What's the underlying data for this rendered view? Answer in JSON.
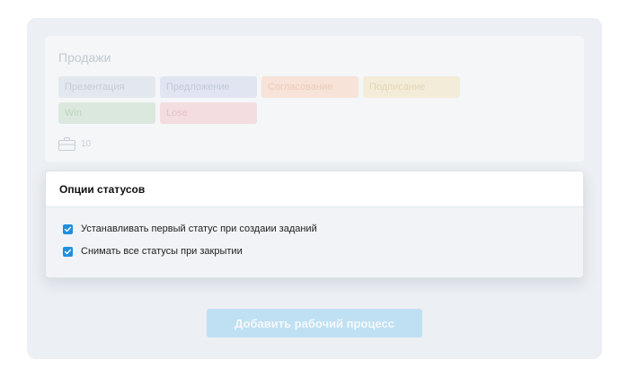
{
  "workflow": {
    "title": "Продажи",
    "statuses": [
      {
        "label": "Презентация",
        "bg": "#e3e8ee",
        "color": "#c6cdd5"
      },
      {
        "label": "Предложение",
        "bg": "#e1e5f1",
        "color": "#c2c9dc"
      },
      {
        "label": "Согласование",
        "bg": "#f7e3d8",
        "color": "#eacbbb"
      },
      {
        "label": "Подписание",
        "bg": "#f3ecd9",
        "color": "#e3d7b6"
      },
      {
        "label": "Win",
        "bg": "#dbe8dd",
        "color": "#bcd5c0"
      },
      {
        "label": "Lose",
        "bg": "#f4dde0",
        "color": "#e8c2c7"
      }
    ],
    "task_count": "10",
    "count_icon": "briefcase-icon"
  },
  "status_options": {
    "title": "Опции статусов",
    "options": [
      {
        "label": "Устанавливать первый статус при создаии заданий",
        "checked": true
      },
      {
        "label": "Снимать все статусы при закрытии",
        "checked": true
      }
    ]
  },
  "add_workflow_button": {
    "label": "Добавить рабочий процесс"
  },
  "colors": {
    "accent": "#1f8fde",
    "button_disabled_bg": "#bfe0f2",
    "panel_bg": "#eceff3"
  }
}
